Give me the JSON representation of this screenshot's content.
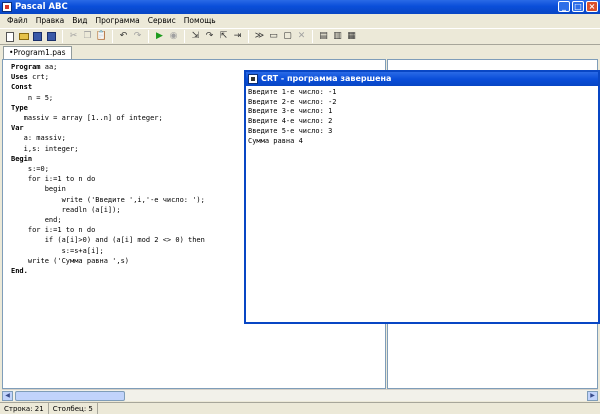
{
  "window": {
    "title": "Pascal ABC"
  },
  "menu": [
    "Файл",
    "Правка",
    "Вид",
    "Программа",
    "Сервис",
    "Помощь"
  ],
  "toolbar": {
    "icons": [
      "new-file-icon",
      "open-folder-icon",
      "save-icon",
      "save-all-icon",
      "cut-icon",
      "copy-icon",
      "paste-icon",
      "undo-icon",
      "redo-icon",
      "run-icon",
      "stop-icon",
      "step-into-icon",
      "step-over-icon",
      "step-out-icon",
      "run-to-cursor-icon",
      "evaluate-icon",
      "watch-icon",
      "window-icon",
      "delete-icon",
      "stack-icon",
      "layout-icon",
      "layout2-icon"
    ]
  },
  "tab": {
    "label": "•Program1.pas"
  },
  "code": {
    "lines": [
      {
        "kw": "Program",
        "rest": " aa;"
      },
      {
        "kw": "Uses",
        "rest": " crt;"
      },
      {
        "kw": "Const",
        "rest": ""
      },
      {
        "kw": "",
        "rest": "    n = 5;"
      },
      {
        "kw": "Type",
        "rest": ""
      },
      {
        "kw": "",
        "rest": "   massiv = array [1..n] of integer;"
      },
      {
        "kw": "Var",
        "rest": ""
      },
      {
        "kw": "",
        "rest": "   a: massiv;"
      },
      {
        "kw": "",
        "rest": "   i,s: integer;"
      },
      {
        "kw": "Begin",
        "rest": ""
      },
      {
        "kw": "",
        "rest": "    s:=0;"
      },
      {
        "kw": "",
        "rest": "    for i:=1 to n do"
      },
      {
        "kw": "",
        "rest": "        begin"
      },
      {
        "kw": "",
        "rest": "            write ('Введите ',i,'-е число: ');"
      },
      {
        "kw": "",
        "rest": "            readln (a[i]);"
      },
      {
        "kw": "",
        "rest": "        end;"
      },
      {
        "kw": "",
        "rest": "    for i:=1 to n do"
      },
      {
        "kw": "",
        "rest": "        if (a[i]>0) and (a[i] mod 2 <> 0) then"
      },
      {
        "kw": "",
        "rest": "            s:=s+a[i];"
      },
      {
        "kw": "",
        "rest": "    write ('Сумма равна ',s)"
      },
      {
        "kw": "End.",
        "rest": ""
      }
    ]
  },
  "crt": {
    "title": "CRT - программа завершена",
    "output": [
      "Введите 1-е число: -1",
      "Введите 2-е число: -2",
      "Введите 3-е число: 1",
      "Введите 4-е число: 2",
      "Введите 5-е число: 3",
      "Сумма равна 4"
    ]
  },
  "status": {
    "row": "Строка: 21",
    "col": "Столбец: 5"
  }
}
